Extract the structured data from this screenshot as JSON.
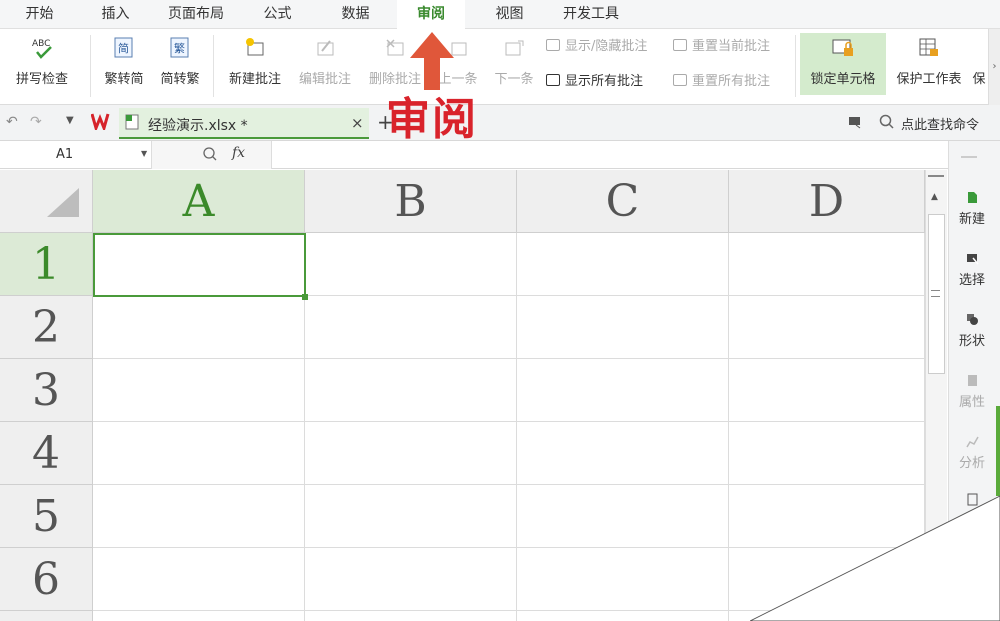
{
  "menu_tabs": [
    "开始",
    "插入",
    "页面布局",
    "公式",
    "数据",
    "审阅",
    "视图",
    "开发工具"
  ],
  "active_tab": "审阅",
  "ribbon": {
    "spell_check": "拼写检查",
    "trad_to_simp": "繁转简",
    "simp_to_trad": "简转繁",
    "new_comment": "新建批注",
    "edit_comment": "编辑批注",
    "delete_comment": "删除批注",
    "prev": "上一条",
    "next": "下一条",
    "show_hide_comment": "显示/隐藏批注",
    "show_all_comments": "显示所有批注",
    "reset_current": "重置当前批注",
    "reset_all": "重置所有批注",
    "lock_cell": "锁定单元格",
    "protect_sheet": "保护工作表",
    "more": "保",
    "abc": "ABC",
    "jian": "简",
    "fan": "繁"
  },
  "doc_tab": {
    "filename": "经验演示.xlsx *",
    "close": "×",
    "add": "+"
  },
  "search_command": "点此查找命令",
  "name_box": "A1",
  "fx": "fx",
  "columns": [
    "A",
    "B",
    "C",
    "D"
  ],
  "rows": [
    "1",
    "2",
    "3",
    "4",
    "5",
    "6"
  ],
  "side_panel": [
    "新建",
    "选择",
    "形状",
    "属性",
    "分析"
  ],
  "annotation": {
    "text": "审阅",
    "color": "#d9232b",
    "arrow_color": "#e0573a"
  },
  "colors": {
    "accent": "#3a8a2e",
    "selected_header": "#dcead6"
  }
}
